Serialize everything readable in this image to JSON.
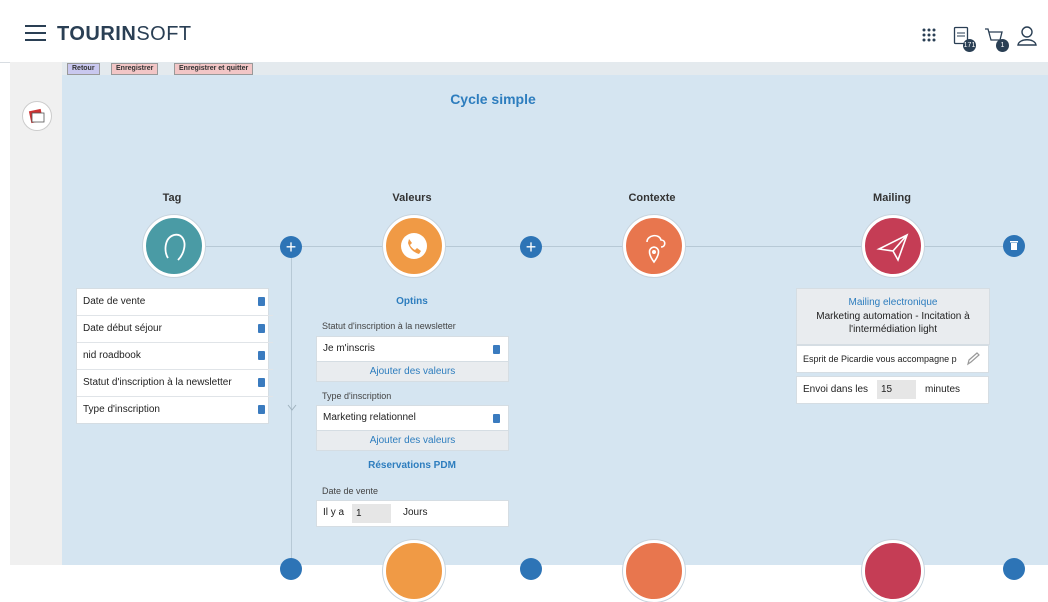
{
  "header": {
    "brand_bold": "TOURIN",
    "brand_rest": "SOFT",
    "tasks_badge": "171",
    "cart_badge": "1"
  },
  "toolbar": {
    "back": "Retour",
    "save": "Enregistrer",
    "save_quit": "Enregistrer et quitter"
  },
  "cycle": {
    "title": "Cycle simple",
    "columns": [
      "Tag",
      "Valeurs",
      "Contexte",
      "Mailing"
    ]
  },
  "tags": [
    "Date de vente",
    "Date début séjour",
    "nid roadbook",
    "Statut d'inscription à la newsletter",
    "Type d'inscription"
  ],
  "values": {
    "optins_title": "Optins",
    "newsletter_label": "Statut d'inscription à la newsletter",
    "newsletter_value": "Je m'inscris",
    "add_values": "Ajouter des valeurs",
    "type_label": "Type d'inscription",
    "type_value": "Marketing relationnel",
    "reservations_title": "Réservations PDM",
    "sale_date_label": "Date de vente",
    "il_ya": "Il y a",
    "days_count": "1",
    "days_unit": "Jours"
  },
  "mailing": {
    "kind": "Mailing electronique",
    "name": "Marketing automation - Incitation à l'intermédiation light",
    "subject": "Esprit de Picardie vous accompagne p",
    "send_prefix": "Envoi dans les",
    "send_minutes": "15",
    "send_unit": "minutes"
  },
  "colors": {
    "tag": "#4a9ba5",
    "valeurs": "#f09a45",
    "contexte": "#e8764e",
    "mailing": "#c53d55",
    "accent": "#2d74b6"
  }
}
